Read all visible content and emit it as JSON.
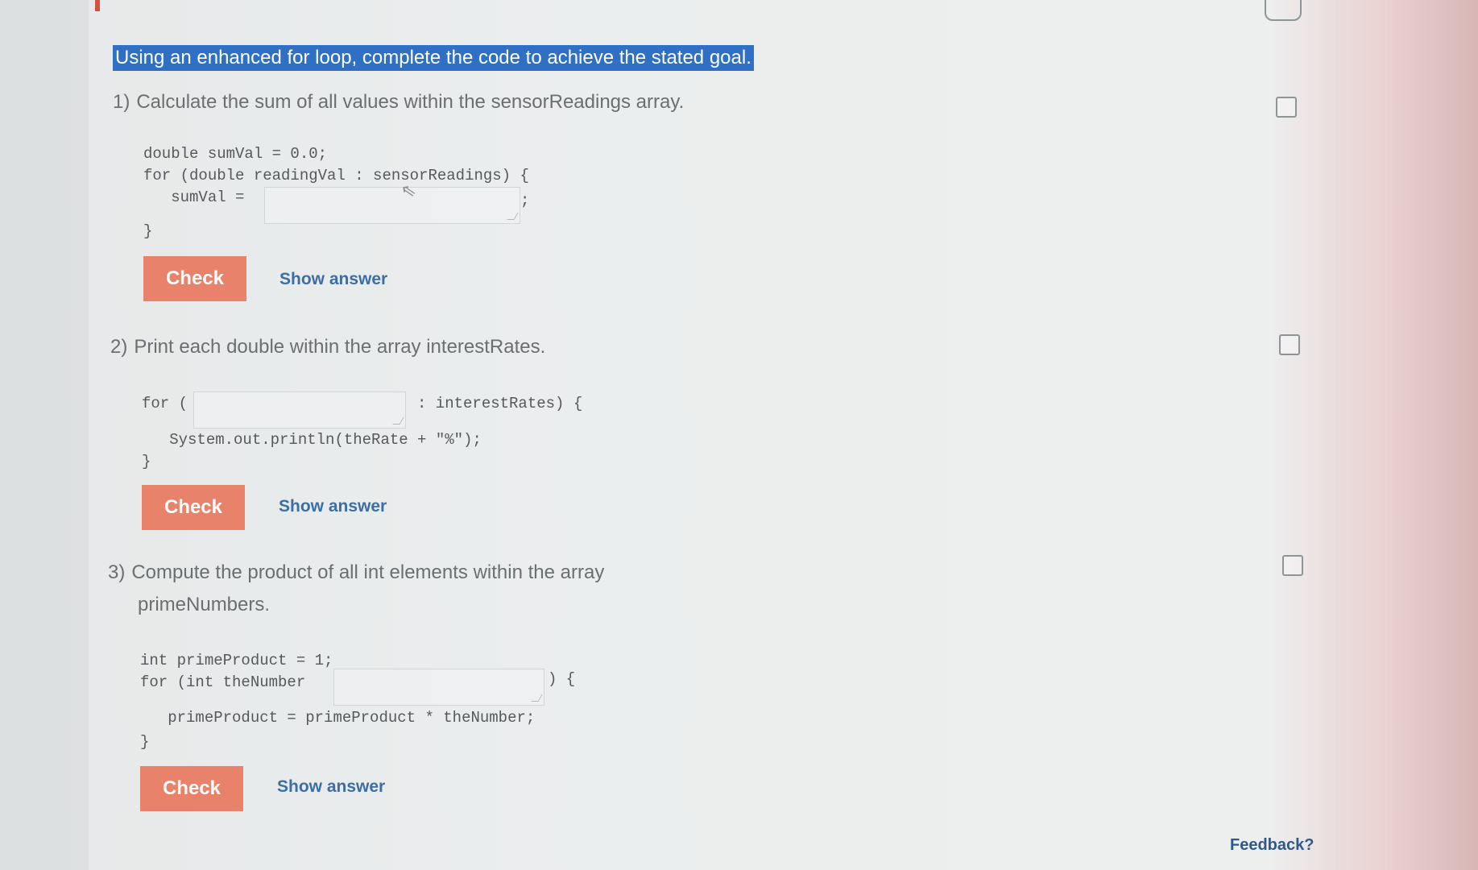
{
  "instructions": "Using an enhanced for loop, complete the code to achieve the stated goal.",
  "questions": [
    {
      "number": "1)",
      "prompt": "Calculate the sum of all values within the sensorReadings array.",
      "code": {
        "line1": "double sumVal = 0.0;",
        "line2": "for (double readingVal : sensorReadings) {",
        "line3_pre": "   sumVal =",
        "line3_post": ";",
        "close": "}"
      },
      "input_value": "",
      "check_label": "Check",
      "show_answer_label": "Show answer"
    },
    {
      "number": "2)",
      "prompt": "Print each double within the array interestRates.",
      "code": {
        "line1_pre": "for (",
        "line1_post": ": interestRates) {",
        "line2": "   System.out.println(theRate + \"%\");",
        "close": "}"
      },
      "input_value": "",
      "check_label": "Check",
      "show_answer_label": "Show answer"
    },
    {
      "number": "3)",
      "prompt_line1": "Compute the product of all int elements within the array",
      "prompt_line2": "primeNumbers.",
      "code": {
        "line1": "int primeProduct = 1;",
        "line2_pre": "for (int theNumber",
        "line2_post": ") {",
        "line3": "   primeProduct = primeProduct * theNumber;",
        "close": "}"
      },
      "input_value": "",
      "check_label": "Check",
      "show_answer_label": "Show answer"
    }
  ],
  "feedback_label": "Feedback?",
  "colors": {
    "accent": "#2f6fc4",
    "check_button": "#e8826a",
    "link": "#3d6ea3"
  }
}
